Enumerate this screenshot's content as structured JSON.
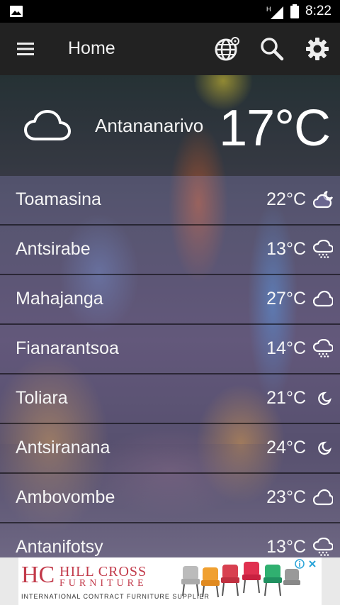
{
  "status_bar": {
    "network_label": "H",
    "time": "8:22"
  },
  "appbar": {
    "title": "Home",
    "icons": [
      "menu-icon",
      "globe-icon",
      "search-icon",
      "gear-icon"
    ]
  },
  "current": {
    "city": "Antananarivo",
    "temp": "17°C",
    "icon": "cloud-icon"
  },
  "cities": [
    {
      "name": "Toamasina",
      "temp": "22°C",
      "icon": "partly-cloudy-night-icon"
    },
    {
      "name": "Antsirabe",
      "temp": "13°C",
      "icon": "rain-cloud-icon"
    },
    {
      "name": "Mahajanga",
      "temp": "27°C",
      "icon": "cloud-icon"
    },
    {
      "name": "Fianarantsoa",
      "temp": "14°C",
      "icon": "rain-cloud-icon"
    },
    {
      "name": "Toliara",
      "temp": "21°C",
      "icon": "moon-icon"
    },
    {
      "name": "Antsiranana",
      "temp": "24°C",
      "icon": "moon-icon"
    },
    {
      "name": "Ambovombe",
      "temp": "23°C",
      "icon": "cloud-icon"
    },
    {
      "name": "Antanifotsy",
      "temp": "13°C",
      "icon": "rain-cloud-icon"
    }
  ],
  "ad": {
    "logo": "HC",
    "brand_line1": "HILL CROSS",
    "brand_line2": "FURNITURE",
    "tagline": "INTERNATIONAL CONTRACT FURNITURE SUPPLIER"
  },
  "colors": {
    "appbar": "#222222",
    "statusbar": "#000000",
    "ad_brand": "#c23a4a"
  }
}
